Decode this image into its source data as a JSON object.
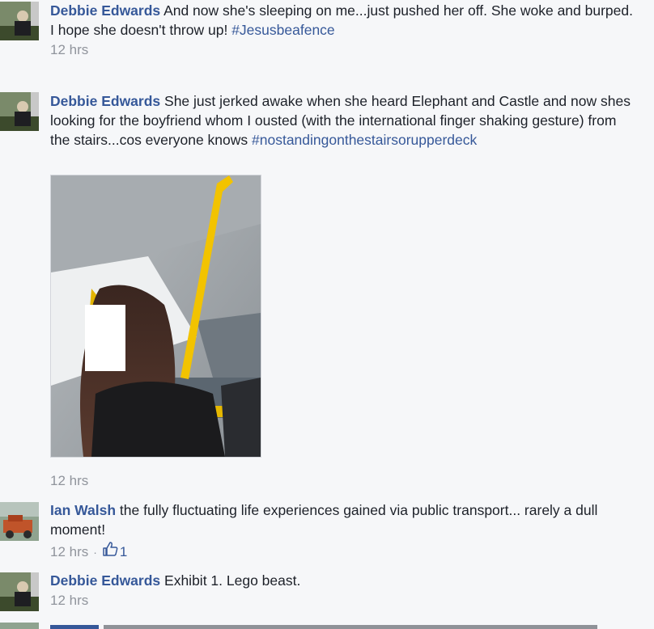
{
  "comments": [
    {
      "author": "Debbie Edwards",
      "text": "And now she's sleeping on me...just pushed her off. She woke and burped.",
      "text2": "I hope she doesn't throw up!",
      "hashtag": "#Jesusbeafence",
      "time": "12 hrs"
    },
    {
      "author": "Debbie Edwards",
      "text": "She just jerked awake when she heard Elephant and Castle and now shes looking for the boyfriend whom I ousted (with the international finger shaking gesture) from the stairs...cos everyone knows",
      "hashtag": "#nostandingonthestairsorupperdeck",
      "time": "12 hrs"
    },
    {
      "author": "Ian Walsh",
      "text": "the fully fluctuating life experiences gained via public transport... rarely a dull moment!",
      "time": "12 hrs",
      "separator": "·",
      "likes": "1"
    },
    {
      "author": "Debbie Edwards",
      "text": "Exhibit 1. Lego beast.",
      "time": "12 hrs"
    }
  ],
  "colors": {
    "link": "#365899",
    "muted": "#90949c",
    "background": "#f6f7f9"
  }
}
